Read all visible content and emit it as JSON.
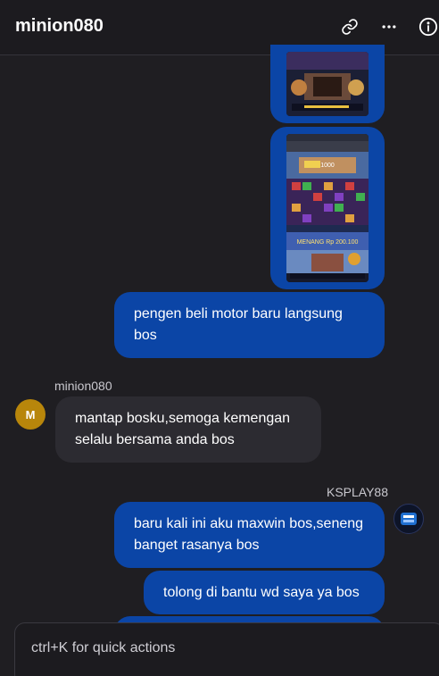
{
  "header": {
    "title": "minion080",
    "icons": [
      "link-icon",
      "more-horizontal-icon",
      "info-icon"
    ]
  },
  "messages": {
    "m1": {
      "text": "pengen beli motor baru langsung bos"
    },
    "m2": {
      "sender": "minion080",
      "avatar_letter": "M",
      "avatar_color": "#b8860b",
      "text": "mantap bosku,semoga kemengan selalu bersama anda bos"
    },
    "m3": {
      "sender": "KSPLAY88",
      "text": "baru kali ini aku maxwin bos,seneng banget rasanya bos"
    },
    "m4": {
      "text": "tolong di bantu wd saya ya bos"
    }
  },
  "screenshot": {
    "banner": "1000",
    "win_label": "MENANG Rp 200.100"
  },
  "composer": {
    "placeholder": "ctrl+K for quick actions"
  },
  "colors": {
    "outgoing": "#0b45a6",
    "incoming": "#2c2b31",
    "background": "#1f1e22"
  }
}
